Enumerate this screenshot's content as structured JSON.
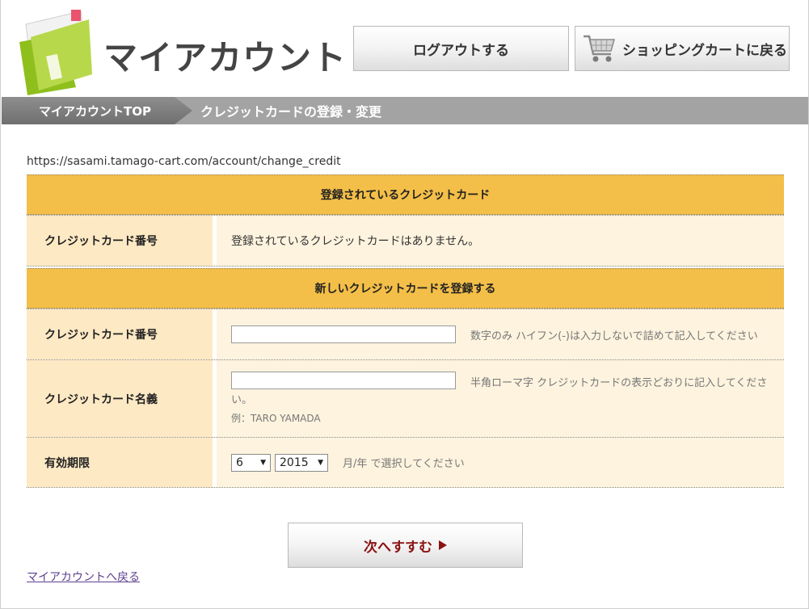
{
  "header": {
    "title": "マイアカウント",
    "logout_label": "ログアウトする",
    "cart_label": "ショッピングカートに戻る"
  },
  "breadcrumb": {
    "top_label": "マイアカウントTOP",
    "current_label": "クレジットカードの登録・変更"
  },
  "url": "https://sasami.tamago-cart.com/account/change_credit",
  "registered": {
    "heading": "登録されているクレジットカード",
    "card_number_label": "クレジットカード番号",
    "card_number_value": "登録されているクレジットカードはありません。"
  },
  "new_card": {
    "heading": "新しいクレジットカードを登録する",
    "number": {
      "label": "クレジットカード番号",
      "value": "",
      "hint": "数字のみ ハイフン(-)は入力しないで詰めて記入してください"
    },
    "name": {
      "label": "クレジットカード名義",
      "value": "",
      "hint_line1": "半角ローマ字 クレジットカードの表示どおりに記入してくださ",
      "hint_line2": "い。",
      "example": "例：TARO YAMADA"
    },
    "expiry": {
      "label": "有効期限",
      "month": "6",
      "year": "2015",
      "hint": "月/年 で選択してください"
    }
  },
  "next_label": "次へすすむ",
  "back_link": "マイアカウントへ戻る",
  "colors": {
    "section_head": "#f4bf48",
    "label_bg": "#fde9c4",
    "value_bg": "#fdf3de",
    "next_text": "#8b1212"
  }
}
